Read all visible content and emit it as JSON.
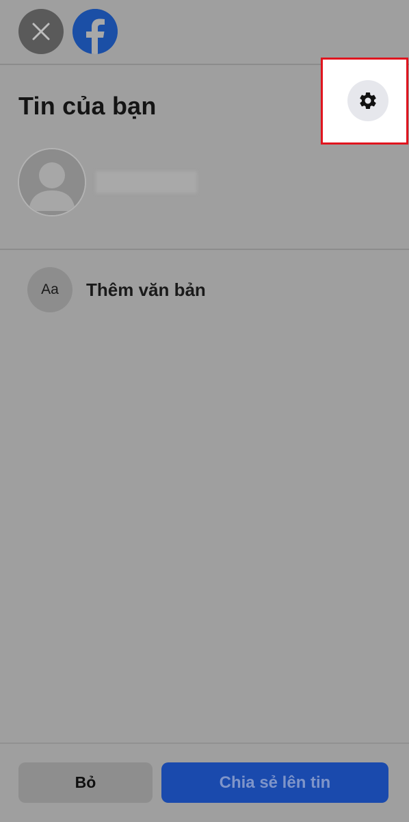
{
  "header": {
    "title": "Tin của bạn"
  },
  "icons": {
    "close": "close-icon",
    "facebook": "facebook-logo-icon",
    "settings": "gear-icon",
    "avatar": "avatar-placeholder-icon"
  },
  "colors": {
    "overlay": "#9f9f9f",
    "highlight_border": "#e0141e",
    "primary_button": "#1a4aad",
    "facebook_blue": "#1b4fa6"
  },
  "compose": {
    "add_text_icon_label": "Aa",
    "add_text_label": "Thêm văn bản"
  },
  "footer": {
    "cancel_label": "Bỏ",
    "share_label": "Chia sẻ lên tin"
  }
}
